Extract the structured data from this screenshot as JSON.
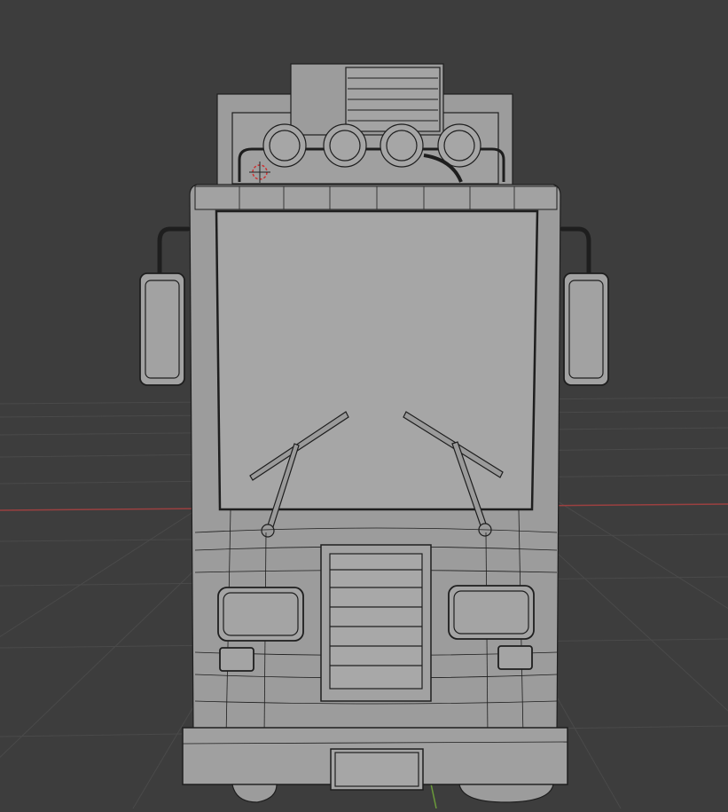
{
  "viewport": {
    "background_color": "#3d3d3d",
    "grid_color": "#4a4a4a",
    "x_axis_color": "#9b4040",
    "y_axis_color": "#6a9a3a",
    "mesh_fill_color": "#9c9c9c",
    "mesh_light_color": "#a8a8a8",
    "wire_color": "#1e1e1e",
    "cursor_color": "#cc3333"
  },
  "scene": {
    "object": "truck-mesh",
    "display_mode": "wireframe-overlay",
    "view": "front-perspective",
    "icons": [
      "3d-cursor-icon"
    ]
  }
}
